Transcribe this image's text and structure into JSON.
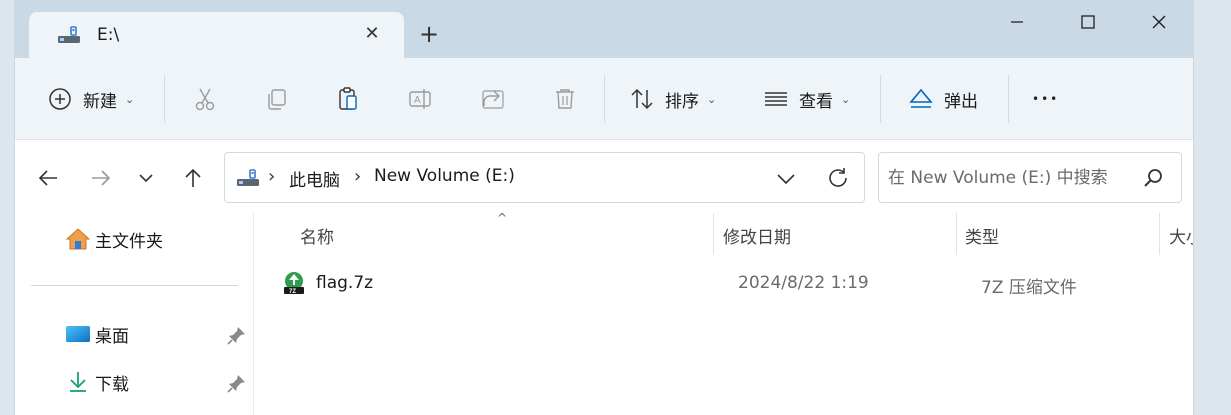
{
  "tab": {
    "title": "E:\\",
    "close_glyph": "✕",
    "new_tab_glyph": "+"
  },
  "window_controls": {
    "minimize": "minimize",
    "maximize": "maximize",
    "close": "close"
  },
  "toolbar": {
    "new_label": "新建",
    "sort_label": "排序",
    "view_label": "查看",
    "eject_label": "弹出",
    "more_glyph": "•••"
  },
  "address": {
    "chevron": "›",
    "segments": [
      "此电脑",
      "New Volume (E:)"
    ]
  },
  "search": {
    "placeholder": "在 New Volume (E:) 中搜索"
  },
  "sidebar": {
    "home": "主文件夹",
    "items": [
      {
        "label": "桌面",
        "icon": "desktop-icon"
      },
      {
        "label": "下载",
        "icon": "download-icon"
      }
    ]
  },
  "columns": {
    "name": "名称",
    "modified": "修改日期",
    "type": "类型",
    "size": "大小"
  },
  "files": [
    {
      "name": "flag.7z",
      "modified": "2024/8/22 1:19",
      "type": "7Z 压缩文件"
    }
  ],
  "colors": {
    "accent": "#0067c0",
    "titlebar": "#c9dae6",
    "toolbar": "#eef4f8"
  }
}
